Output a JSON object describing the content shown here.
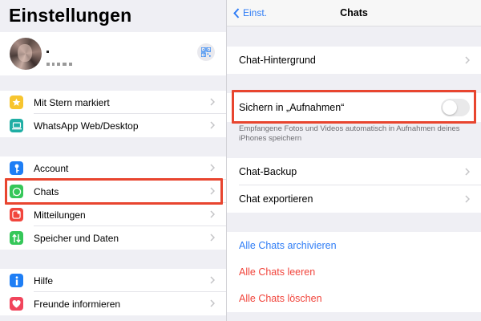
{
  "left": {
    "title": "Einstellungen",
    "profile": {
      "avatar_icon": "avatar-photo",
      "qr_icon": "qr-code-icon"
    },
    "group1": [
      {
        "label": "Mit Stern markiert",
        "icon": "star-icon",
        "color": "#f7c52f"
      },
      {
        "label": "WhatsApp Web/Desktop",
        "icon": "laptop-icon",
        "color": "#1faea4"
      }
    ],
    "group2": [
      {
        "label": "Account",
        "icon": "key-icon",
        "color": "#1e7ef5"
      },
      {
        "label": "Chats",
        "icon": "whatsapp-icon",
        "color": "#35c759"
      },
      {
        "label": "Mitteilungen",
        "icon": "notification-icon",
        "color": "#f1453c"
      },
      {
        "label": "Speicher und Daten",
        "icon": "storage-arrows-icon",
        "color": "#35c759"
      }
    ],
    "group3": [
      {
        "label": "Hilfe",
        "icon": "info-icon",
        "color": "#1e7ef5"
      },
      {
        "label": "Freunde informieren",
        "icon": "heart-icon",
        "color": "#f1455c"
      }
    ],
    "highlight_color": "#e8452f"
  },
  "right": {
    "back_label": "Einst.",
    "title": "Chats",
    "chat_background": "Chat-Hintergrund",
    "save_to_photos": {
      "label": "Sichern in „Aufnahmen“",
      "enabled": false
    },
    "save_hint": "Empfangene Fotos und Videos automatisch in Aufnahmen deines iPhones speichern",
    "chat_backup": "Chat-Backup",
    "export_chat": "Chat exportieren",
    "archive_all": "Alle Chats archivieren",
    "clear_all": "Alle Chats leeren",
    "delete_all": "Alle Chats löschen",
    "colors": {
      "link": "#2f7df6",
      "destructive": "#f1453c",
      "highlight": "#e8452f"
    }
  }
}
